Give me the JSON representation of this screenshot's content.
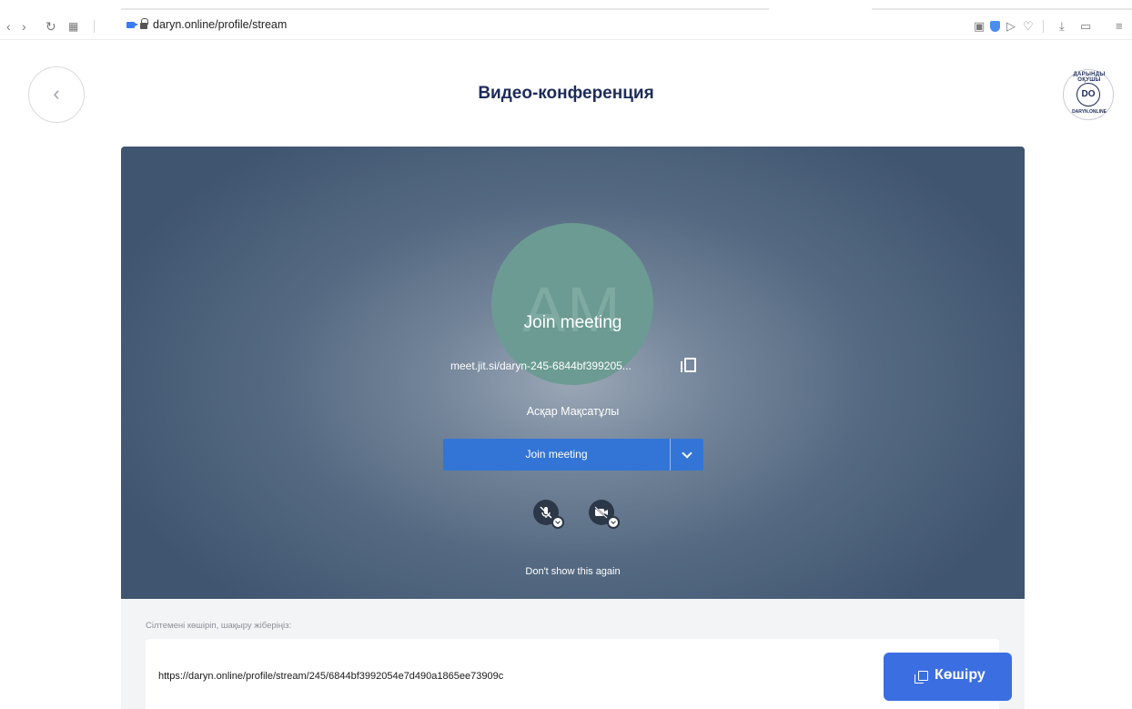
{
  "browser": {
    "url": "daryn.online/profile/stream"
  },
  "header": {
    "title": "Видео-конференция",
    "logo_text": "DO",
    "logo_arc_top": "ДАРЫНДЫ ОҚУШЫ",
    "logo_arc_bottom": "DARYN.ONLINE"
  },
  "conference": {
    "avatar_initials": "AM",
    "join_title": "Join meeting",
    "meeting_url": "meet.jit.si/daryn-245-6844bf399205...",
    "user_name": "Асқар Мақсатұлы",
    "join_button_label": "Join meeting",
    "dont_show_label": "Don't show this again",
    "avatar_color": "#6b9b92",
    "button_color": "#3275d6"
  },
  "share": {
    "label": "Сілтемені көшіріп, шақыру жіберіңіз:",
    "link": "https://daryn.online/profile/stream/245/6844bf3992054e7d490a1865ee73909c",
    "copy_button_label": "Көшіру",
    "accent": "#3b6ee0"
  }
}
